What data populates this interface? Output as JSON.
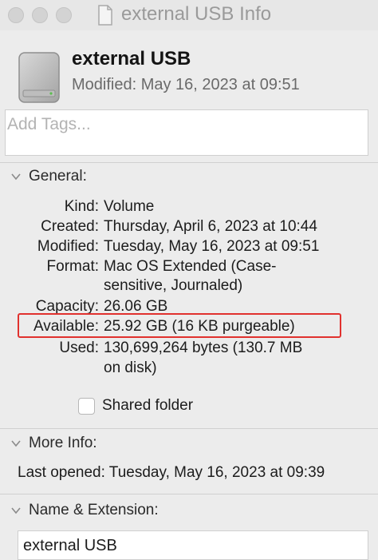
{
  "window": {
    "title": "external USB Info"
  },
  "header": {
    "name": "external USB",
    "modified": "Modified: May 16, 2023 at 09:51"
  },
  "tags": {
    "placeholder": "Add Tags..."
  },
  "general": {
    "title": "General:",
    "rows": [
      {
        "label": "Kind:",
        "value": "Volume"
      },
      {
        "label": "Created:",
        "value": "Thursday, April 6, 2023 at 10:44"
      },
      {
        "label": "Modified:",
        "value": "Tuesday, May 16, 2023 at 09:51"
      },
      {
        "label": "Format:",
        "value": "Mac OS Extended (Case-",
        "value2": "sensitive, Journaled)"
      },
      {
        "label": "Capacity:",
        "value": "26.06 GB"
      },
      {
        "label": "Available:",
        "value": "25.92 GB (16 KB purgeable)"
      },
      {
        "label": "Used:",
        "value": "130,699,264 bytes (130.7 MB",
        "value2": "on disk)"
      }
    ],
    "shared_folder_label": "Shared folder",
    "shared_folder_checked": false
  },
  "more_info": {
    "title": "More Info:",
    "last_opened": "Last opened: Tuesday, May 16, 2023 at 09:39"
  },
  "name_extension": {
    "title": "Name & Extension:",
    "value": "external USB"
  },
  "colors": {
    "highlight": "#e1312e",
    "background": "#ececec"
  },
  "icons": [
    "close-traffic-light",
    "minimize-traffic-light",
    "zoom-traffic-light",
    "document-icon",
    "external-drive-icon",
    "chevron-down-icon"
  ]
}
